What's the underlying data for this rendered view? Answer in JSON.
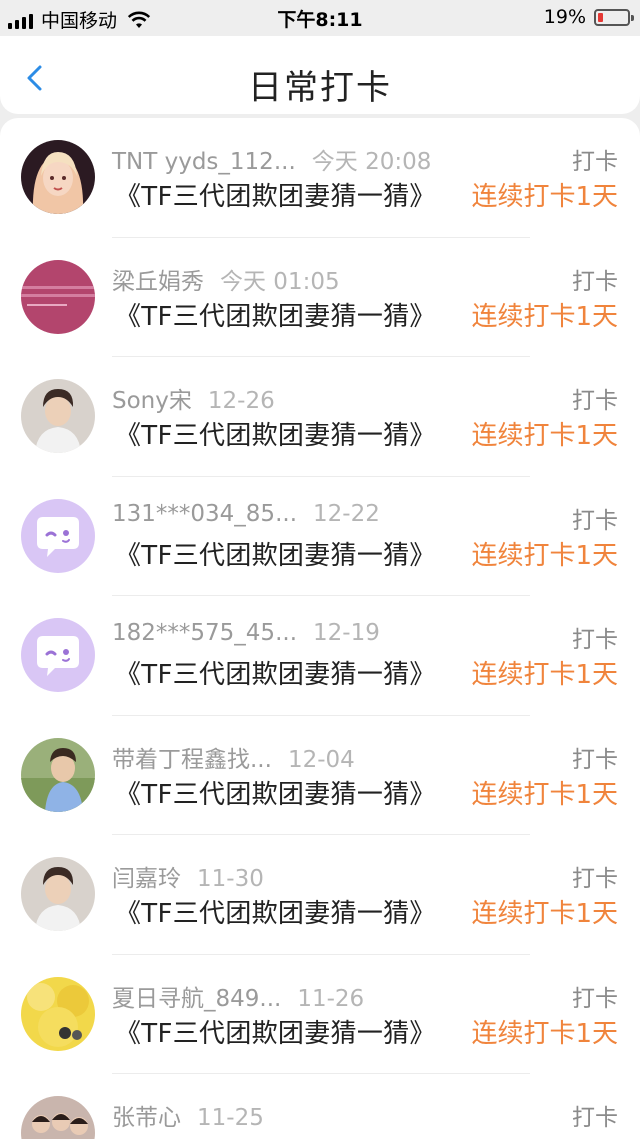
{
  "status_bar": {
    "carrier": "中国移动",
    "time": "下午8:11",
    "battery_percent": "19%",
    "battery_level": 0.19,
    "battery_color": "#e53935"
  },
  "nav": {
    "back_icon": "chevron-left-icon",
    "title": "日常打卡"
  },
  "colors": {
    "accent_blue": "#2c8ce6",
    "streak_orange": "#f0843c"
  },
  "items": [
    {
      "name": "TNT yyds_112...",
      "time": "今天 20:08",
      "tag": "打卡",
      "title": "《TF三代团欺团妻猜一猜》",
      "streak": "连续打卡1天",
      "avatar": "avatar-illustrated-girl"
    },
    {
      "name": "梁丘娟秀",
      "time": "今天 01:05",
      "tag": "打卡",
      "title": "《TF三代团欺团妻猜一猜》",
      "streak": "连续打卡1天",
      "avatar": "avatar-pink-text"
    },
    {
      "name": "Sony宋",
      "time": "12-26",
      "tag": "打卡",
      "title": "《TF三代团欺团妻猜一猜》",
      "streak": "连续打卡1天",
      "avatar": "avatar-photo-person"
    },
    {
      "name": "131***034_85...",
      "time": "12-22",
      "tag": "打卡",
      "title": "《TF三代团欺团妻猜一猜》",
      "streak": "连续打卡1天",
      "avatar": "avatar-default-purple"
    },
    {
      "name": "182***575_45...",
      "time": "12-19",
      "tag": "打卡",
      "title": "《TF三代团欺团妻猜一猜》",
      "streak": "连续打卡1天",
      "avatar": "avatar-default-purple"
    },
    {
      "name": "带着丁程鑫找...",
      "time": "12-04",
      "tag": "打卡",
      "title": "《TF三代团欺团妻猜一猜》",
      "streak": "连续打卡1天",
      "avatar": "avatar-photo-outdoor"
    },
    {
      "name": "闫嘉玲",
      "time": "11-30",
      "tag": "打卡",
      "title": "《TF三代团欺团妻猜一猜》",
      "streak": "连续打卡1天",
      "avatar": "avatar-photo-person"
    },
    {
      "name": "夏日寻航_849...",
      "time": "11-26",
      "tag": "打卡",
      "title": "《TF三代团欺团妻猜一猜》",
      "streak": "连续打卡1天",
      "avatar": "avatar-photo-yellow"
    },
    {
      "name": "张芾心",
      "time": "11-25",
      "tag": "打卡",
      "title": "",
      "streak": "",
      "avatar": "avatar-photo-group"
    }
  ]
}
